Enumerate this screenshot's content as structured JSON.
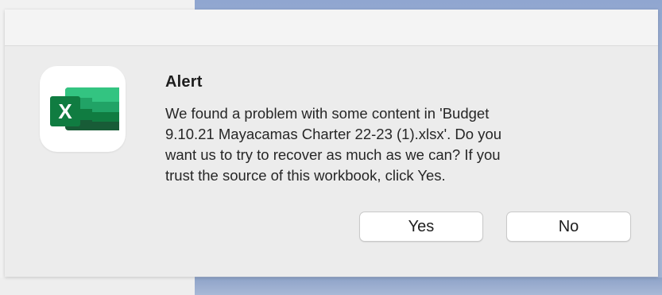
{
  "dialog": {
    "title": "Alert",
    "message_lines": [
      "We found a problem with some content in 'Budget",
      "9.10.21 Mayacamas Charter 22-23 (1).xlsx'. Do you",
      "want us to try to recover as much as we can? If you",
      "trust the source of this workbook, click Yes."
    ],
    "icon": "excel-app-icon",
    "icon_letter": "X",
    "buttons": {
      "yes_label": "Yes",
      "no_label": "No"
    }
  },
  "colors": {
    "excel_green_dark": "#185c37",
    "excel_green": "#21a366",
    "excel_green_mid": "#107c41",
    "excel_green_light": "#33c481",
    "background_blue": "#9fb2d4",
    "dialog_gray": "#ececec"
  }
}
